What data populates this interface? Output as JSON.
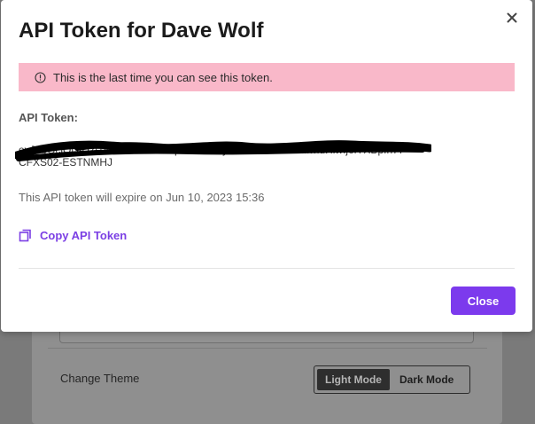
{
  "modal": {
    "title": "API Token for Dave Wolf",
    "alert": {
      "text": "This is the last time you can see this token.",
      "icon": "info-circle-icon"
    },
    "token_label": "API Token:",
    "token_value_line1": "eyJhbGciOiJIUzI1NiIsInR5cCI6IkpXVCJ9.eyJzdWIiOiJkYXZlIiwidHlwIjoiYXBpIn77",
    "token_value_line2": "CFXS02-ESTNMHJ",
    "expiry_text": "This API token will expire on Jun 10, 2023 15:36",
    "copy_label": "Copy API Token",
    "copy_icon": "copy-icon",
    "close_label": "Close",
    "close_icon": "close-icon"
  },
  "background": {
    "theme_label": "Change Theme",
    "theme_options": [
      "Light Mode",
      "Dark Mode"
    ],
    "theme_selected": "Light Mode"
  },
  "colors": {
    "accent": "#7c3aed",
    "link": "#7b3fe4",
    "alert_bg": "#f9b8c9"
  }
}
